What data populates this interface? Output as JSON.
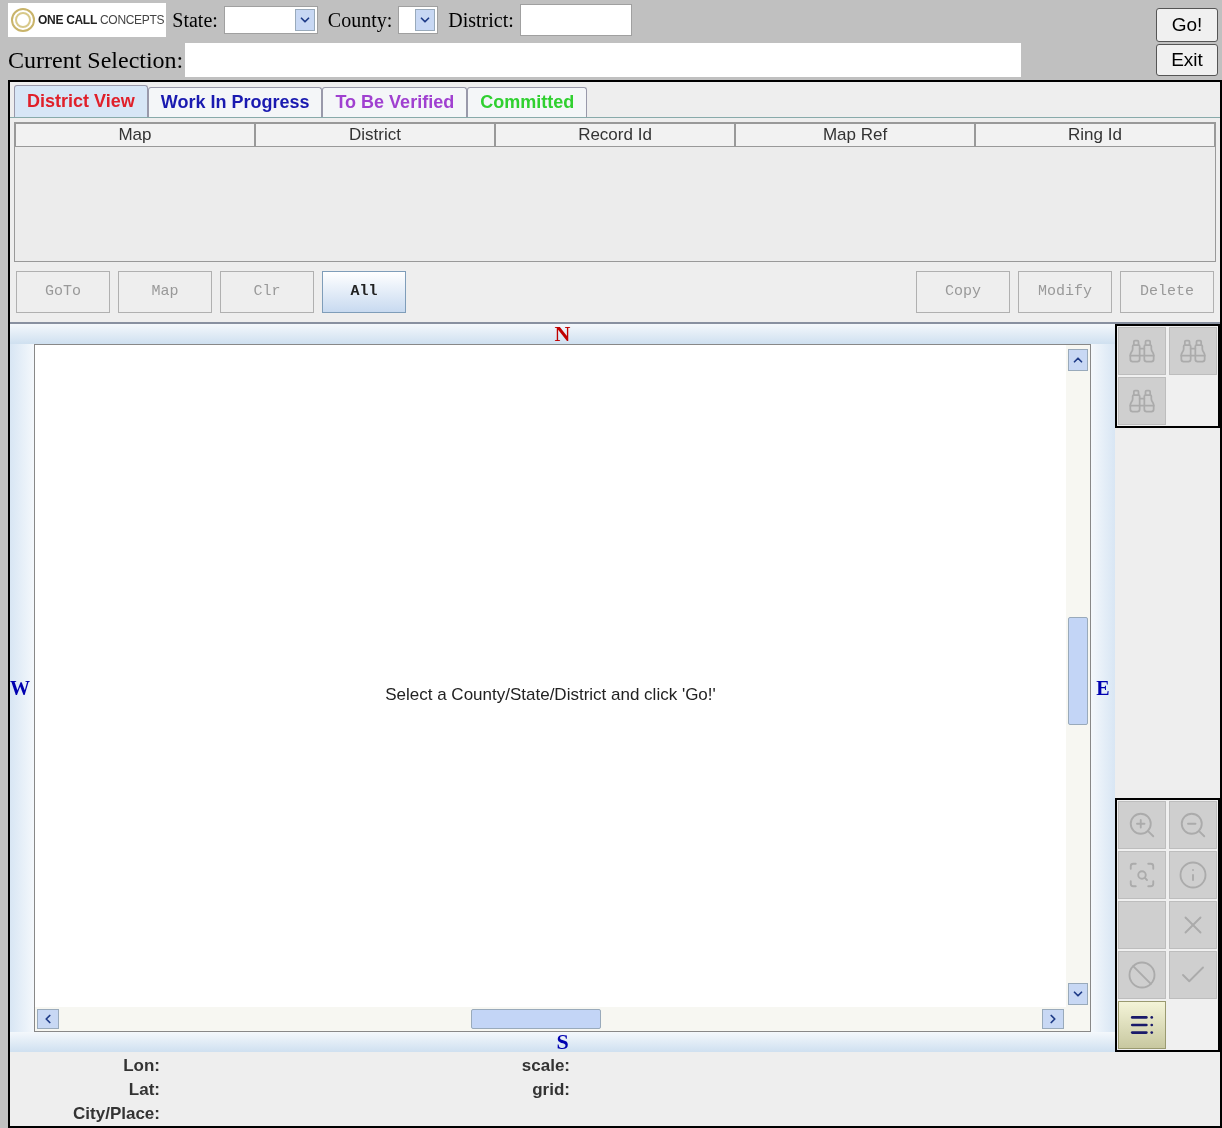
{
  "header": {
    "logo": {
      "word_1": "ONE CALL",
      "word_2": "CONCEPTS"
    },
    "state_label": "State:",
    "county_label": "County:",
    "district_label": "District:",
    "go_button": "Go!",
    "current_selection_label": "Current Selection:",
    "exit_button": "Exit"
  },
  "tabs": [
    {
      "label": "District View",
      "selected": true,
      "color": "#e0202a"
    },
    {
      "label": "Work In Progress",
      "selected": false,
      "color": "#1a1ab0"
    },
    {
      "label": "To Be Verified",
      "selected": false,
      "color": "#a040d0"
    },
    {
      "label": "Committed",
      "selected": false,
      "color": "#30d030"
    }
  ],
  "table": {
    "columns": [
      "Map",
      "District",
      "Record Id",
      "Map Ref",
      "Ring Id"
    ]
  },
  "left_buttons": [
    {
      "label": "GoTo",
      "disabled": true
    },
    {
      "label": "Map",
      "disabled": true
    },
    {
      "label": "Clr",
      "disabled": true
    },
    {
      "label": "All",
      "disabled": false
    }
  ],
  "right_buttons": [
    {
      "label": "Copy",
      "disabled": true
    },
    {
      "label": "Modify",
      "disabled": true
    },
    {
      "label": "Delete",
      "disabled": true
    }
  ],
  "map": {
    "north": "N",
    "south": "S",
    "west": "W",
    "east": "E",
    "message": "Select a County/State/District and click 'Go!'"
  },
  "search_tools": [
    {
      "disabled": true
    },
    {
      "disabled": true
    },
    {
      "disabled": true
    }
  ],
  "map_tools": [
    {
      "disabled": true
    },
    {
      "disabled": true
    },
    {
      "disabled": true
    },
    {
      "disabled": true
    },
    {
      "disabled": true
    },
    {
      "disabled": true
    },
    {
      "disabled": true
    },
    {
      "disabled": true
    },
    {
      "disabled": false
    }
  ],
  "info": {
    "lon_label": "Lon:",
    "lat_label": "Lat:",
    "city_label": "City/Place:",
    "scale_label": "scale:",
    "grid_label": "grid:"
  }
}
